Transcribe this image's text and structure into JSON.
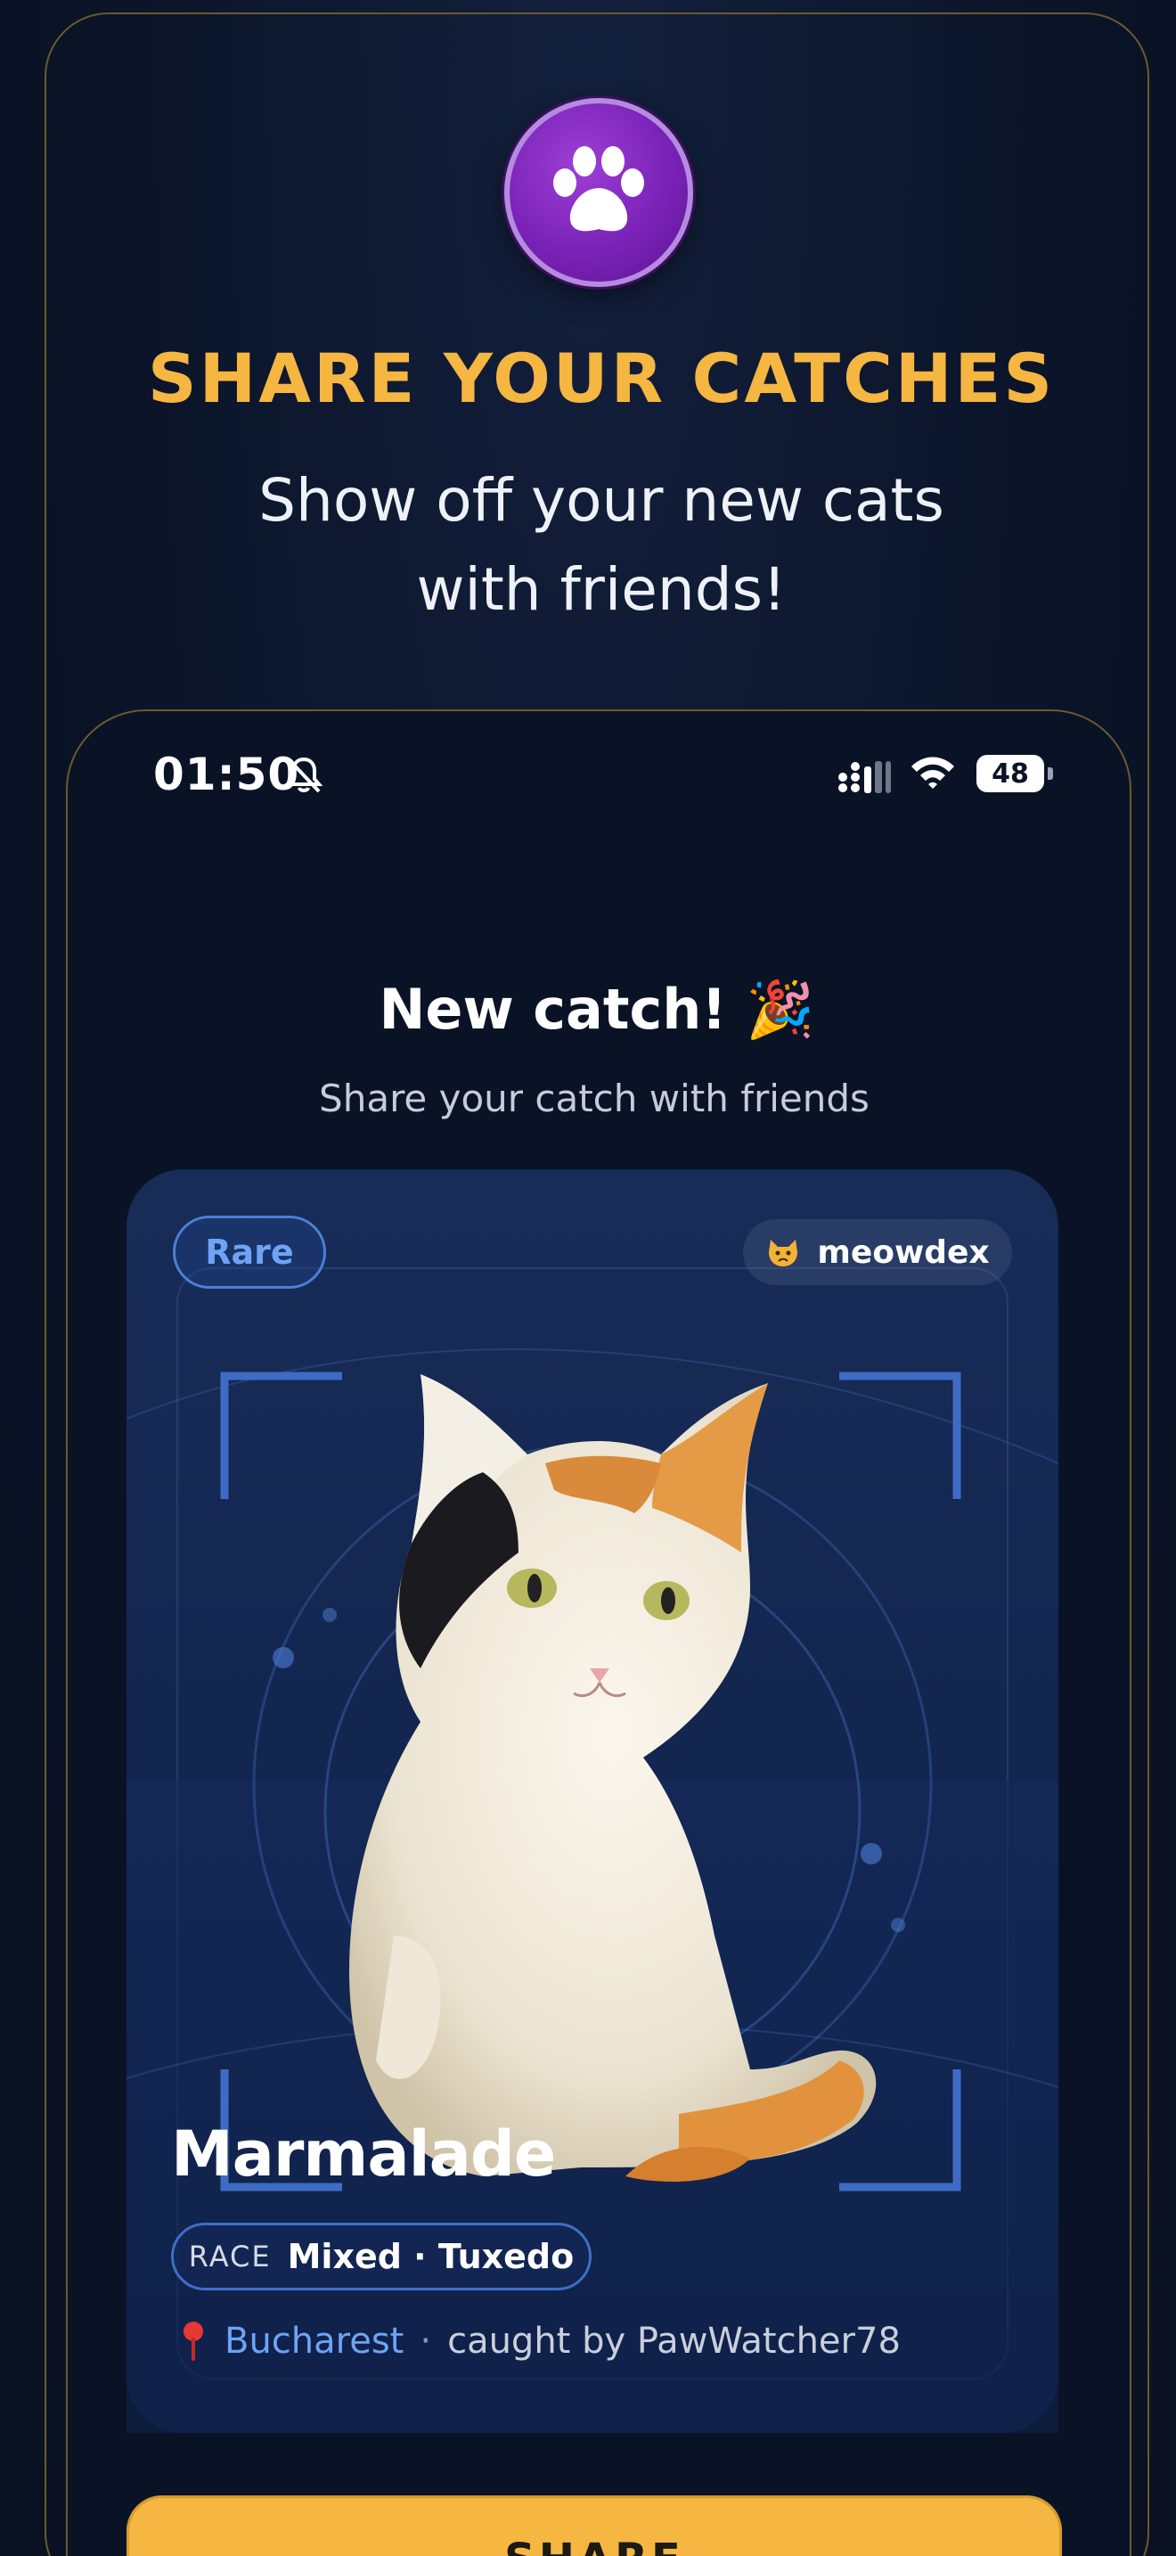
{
  "promo": {
    "headline": "SHARE YOUR CATCHES",
    "subhead_line1": "Show off your new cats",
    "subhead_line2": "with friends!",
    "badge_icon": "paw-icon"
  },
  "status_bar": {
    "time": "01:50",
    "battery": "48",
    "icons": [
      "mute-icon",
      "signal-icon",
      "wifi-icon",
      "battery-icon"
    ]
  },
  "screen": {
    "title": "New catch! 🎉",
    "subtitle": "Share your catch with friends"
  },
  "catch_card": {
    "rarity": "Rare",
    "brand_emoji": "😾",
    "brand": "meowdex",
    "cat_name": "Marmalade",
    "race_label": "RACE",
    "race_value": "Mixed · Tuxedo",
    "location": "Bucharest",
    "separator": "·",
    "caught_by": "caught by PawWatcher78"
  },
  "actions": {
    "share_label": "SHARE"
  },
  "colors": {
    "accent": "#f5b642",
    "badge_purple": "#7a22b8",
    "link_blue": "#6fa3f4",
    "background": "#0b1428",
    "card": "#152a55"
  }
}
